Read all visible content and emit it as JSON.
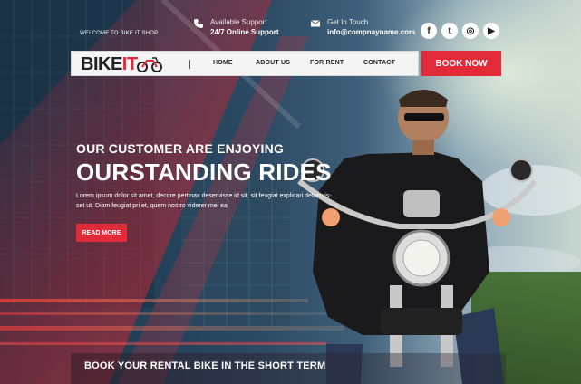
{
  "topbar": {
    "welcome": "WELCOME TO BIKE IT SHOP",
    "support": {
      "label": "Available Support",
      "value": "24/7 Online Support",
      "icon": "phone-icon"
    },
    "contact": {
      "label": "Get In Touch",
      "value": "info@compnayname.com",
      "icon": "mail-icon"
    },
    "social": [
      {
        "name": "facebook-icon",
        "glyph": "f"
      },
      {
        "name": "twitter-icon",
        "glyph": "t"
      },
      {
        "name": "instagram-icon",
        "glyph": "◎"
      },
      {
        "name": "youtube-icon",
        "glyph": "▶"
      }
    ]
  },
  "navbar": {
    "logo_bike": "BIKE",
    "logo_it": "IT",
    "items": [
      "HOME",
      "ABOUT US",
      "FOR RENT",
      "CONTACT"
    ],
    "book_now": "BOOK NOW"
  },
  "hero": {
    "subtitle": "OUR CUSTOMER ARE ENJOYING",
    "title": "OURSTANDING RIDES",
    "body": "Lorem ipsum dolor sit amet, decore pertinax deseruisse id sit, sit feugiat explicari deterruis-set ut. Diam feugiat pri et, quem nostro viderer mei ea",
    "read_more": "READ MORE"
  },
  "footer": {
    "tagline": "BOOK YOUR RENTAL BIKE IN THE SHORT TERM"
  },
  "colors": {
    "accent": "#e12b39",
    "nav_bg": "#f4f4f4"
  }
}
